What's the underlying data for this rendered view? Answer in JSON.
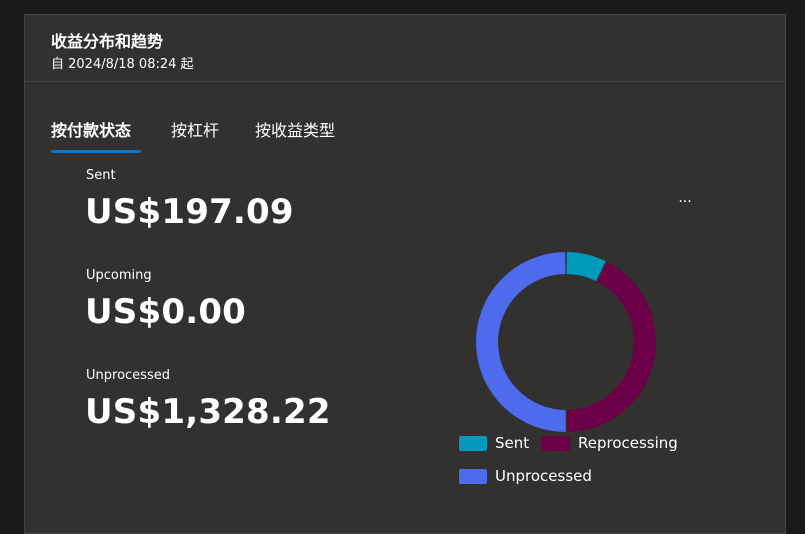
{
  "header": {
    "title": "收益分布和趋势",
    "subtitle": "自 2024/8/18 08:24 起"
  },
  "tabs": [
    {
      "label": "按付款状态",
      "active": true
    },
    {
      "label": "按杠杆",
      "active": false
    },
    {
      "label": "按收益类型",
      "active": false
    }
  ],
  "metrics": [
    {
      "label": "Sent",
      "value": "US$197.09"
    },
    {
      "label": "Upcoming",
      "value": "US$0.00"
    },
    {
      "label": "Unprocessed",
      "value": "US$1,328.22"
    }
  ],
  "more_button": {
    "label": "..."
  },
  "colors": {
    "sent": "#0099bc",
    "reprocessing": "#6b0049",
    "unprocessed": "#4f6bed",
    "accent": "#0078d4"
  },
  "chart_data": {
    "type": "pie",
    "donut": true,
    "title": "",
    "series": [
      {
        "name": "Sent",
        "value": 197.09,
        "color": "#0099bc"
      },
      {
        "name": "Reprocessing",
        "value": 1127.0,
        "color": "#6b0049"
      },
      {
        "name": "Unprocessed",
        "value": 1328.22,
        "color": "#4f6bed"
      }
    ],
    "legend": [
      "Sent",
      "Reprocessing",
      "Unprocessed"
    ],
    "legend_position": "bottom"
  }
}
